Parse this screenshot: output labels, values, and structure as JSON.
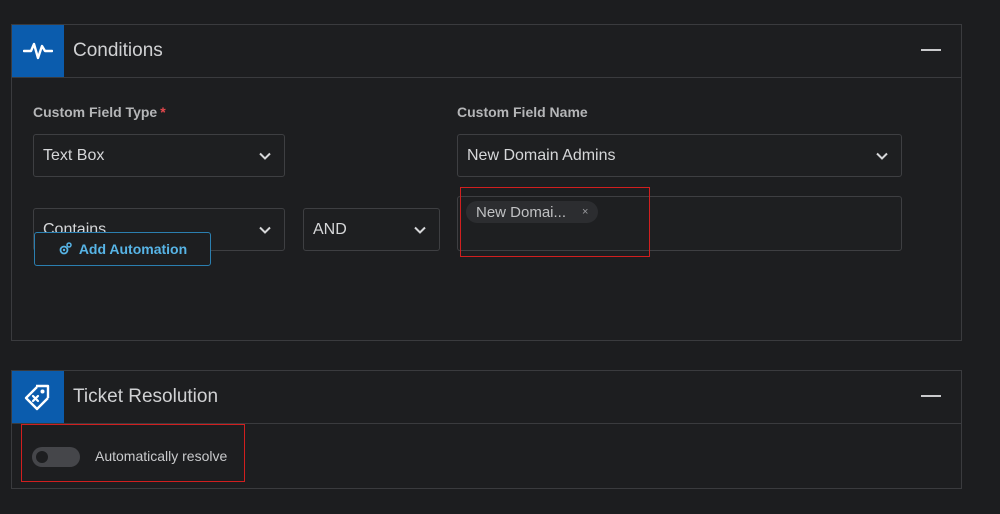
{
  "conditions": {
    "title": "Conditions",
    "custom_field_type_label": "Custom Field Type",
    "required_marker": "*",
    "custom_field_type_value": "Text Box",
    "custom_field_name_label": "Custom Field Name",
    "custom_field_name_value": "New Domain Admins",
    "operator_value": "Contains",
    "logic_value": "AND",
    "tag_value": "New Domai...",
    "tag_remove": "×",
    "add_automation_label": "Add Automation"
  },
  "ticket_resolution": {
    "title": "Ticket Resolution",
    "auto_resolve_label": "Automatically resolve",
    "auto_resolve_enabled": false
  },
  "icons": [
    "activity-icon",
    "chevron-down-icon",
    "tag-remove-icon",
    "automation-icon",
    "collapse-icon"
  ],
  "colors": {
    "accent": "#0b5cad",
    "link": "#57b4e6",
    "highlight": "#d11f1f",
    "required": "#e5484d"
  }
}
